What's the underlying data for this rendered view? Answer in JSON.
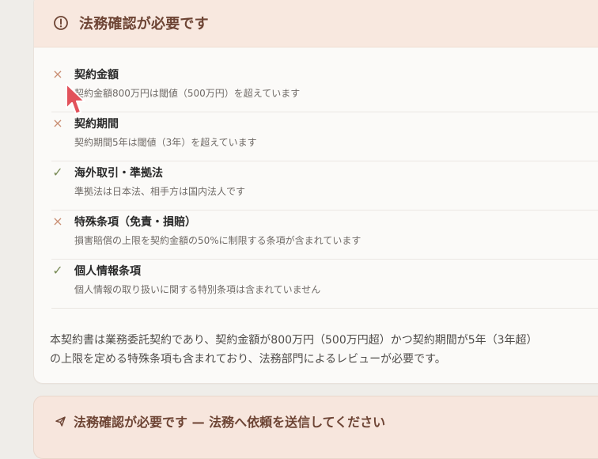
{
  "header": {
    "title": "法務確認が必要です",
    "icon": "alert-circle-icon"
  },
  "items": [
    {
      "status": "ng",
      "mark": "×",
      "title": "契約金額",
      "description": "契約金額800万円は閾値（500万円）を超えています"
    },
    {
      "status": "ng",
      "mark": "×",
      "title": "契約期間",
      "description": "契約期間5年は閾値（3年）を超えています"
    },
    {
      "status": "ok",
      "mark": "✓",
      "title": "海外取引・準拠法",
      "description": "準拠法は日本法、相手方は国内法人です"
    },
    {
      "status": "ng",
      "mark": "×",
      "title": "特殊条項（免責・損賠）",
      "description": "損害賠償の上限を契約金額の50%に制限する条項が含まれています"
    },
    {
      "status": "ok",
      "mark": "✓",
      "title": "個人情報条項",
      "description": "個人情報の取り扱いに関する特別条項は含まれていません"
    }
  ],
  "summary": {
    "line1": "本契約書は業務委託契約であり、契約金額が800万円（500万円超）かつ契約期間が5年（3年超）",
    "line2": "の上限を定める特殊条項も含まれており、法務部門によるレビューが必要です。"
  },
  "send_panel": {
    "title": "法務確認が必要です — 法務へ依頼を送信してください",
    "icon": "send-icon"
  },
  "colors": {
    "accent_text": "#6d4434",
    "header_bg": "#f8e8df",
    "ng_mark": "#c98e73",
    "ok_mark": "#7a8c58"
  }
}
